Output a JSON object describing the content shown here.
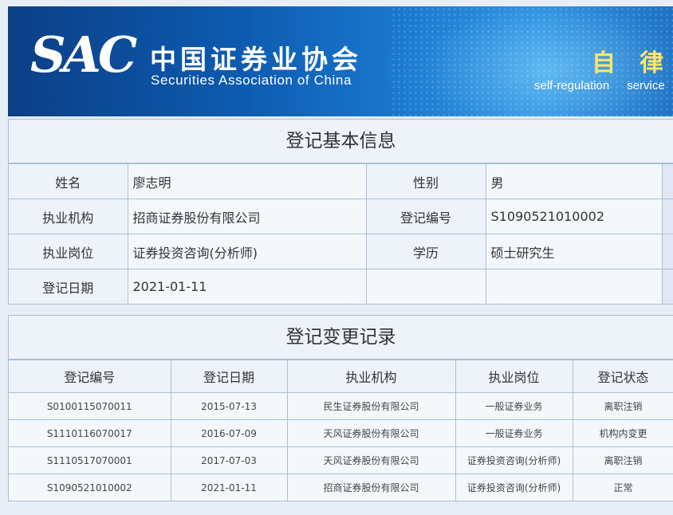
{
  "header": {
    "logo_text": "SAC",
    "org_name_cn": "中国证券业协会",
    "org_name_en": "Securities Association of China",
    "slogan_cn": "自律 服",
    "slogan_en": [
      "self-regulation",
      "service"
    ]
  },
  "basic_info": {
    "title": "登记基本信息",
    "labels": {
      "name": "姓名",
      "gender": "性别",
      "institution": "执业机构",
      "reg_no": "登记编号",
      "position": "执业岗位",
      "education": "学历",
      "reg_date": "登记日期"
    },
    "values": {
      "name": "廖志明",
      "gender": "男",
      "institution": "招商证券股份有限公司",
      "reg_no": "S1090521010002",
      "position": "证券投资咨询(分析师)",
      "education": "硕士研究生",
      "reg_date": "2021-01-11"
    }
  },
  "change_records": {
    "title": "登记变更记录",
    "columns": [
      "登记编号",
      "登记日期",
      "执业机构",
      "执业岗位",
      "登记状态"
    ],
    "rows": [
      [
        "S0100115070011",
        "2015-07-13",
        "民生证券股份有限公司",
        "一般证券业务",
        "离职注销"
      ],
      [
        "S1110116070017",
        "2016-07-09",
        "天风证券股份有限公司",
        "一般证券业务",
        "机构内变更"
      ],
      [
        "S1110517070001",
        "2017-07-03",
        "天风证券股份有限公司",
        "证券投资咨询(分析师)",
        "离职注销"
      ],
      [
        "S1090521010002",
        "2021-01-11",
        "招商证券股份有限公司",
        "证券投资咨询(分析师)",
        "正常"
      ]
    ]
  }
}
